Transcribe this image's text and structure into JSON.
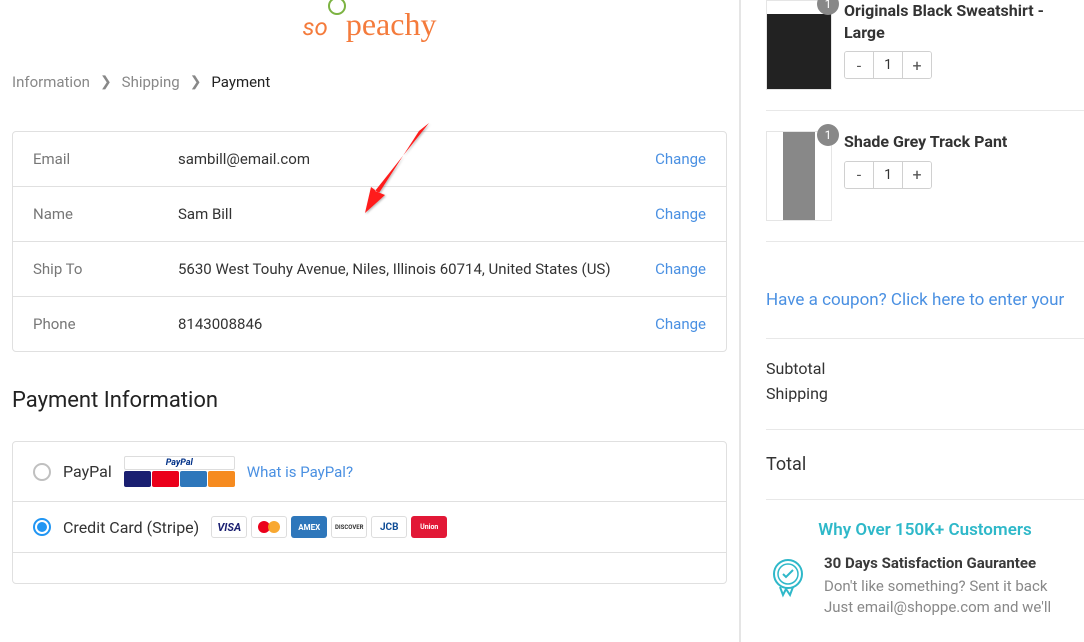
{
  "logo": {
    "part1": "so",
    "part2": "peachy"
  },
  "breadcrumbs": {
    "info": "Information",
    "shipping": "Shipping",
    "payment": "Payment"
  },
  "info": {
    "rows": [
      {
        "label": "Email",
        "value": "sambill@email.com",
        "change": "Change"
      },
      {
        "label": "Name",
        "value": "Sam Bill",
        "change": "Change"
      },
      {
        "label": "Ship To",
        "value": "5630 West Touhy Avenue, Niles, Illinois 60714, United States (US)",
        "change": "Change"
      },
      {
        "label": "Phone",
        "value": "8143008846",
        "change": "Change"
      }
    ]
  },
  "payment": {
    "title": "Payment Information",
    "options": {
      "paypal": {
        "label": "PayPal",
        "link": "What is PayPal?",
        "badge": "PayPal"
      },
      "stripe": {
        "label": "Credit Card (Stripe)"
      }
    }
  },
  "cart": {
    "items": [
      {
        "name": "Originals Black Sweatshirt - Large",
        "qty": "1"
      },
      {
        "name": "Shade Grey Track Pant",
        "qty": "1"
      }
    ],
    "coupon": "Have a coupon? Click here to enter your",
    "subtotal_label": "Subtotal",
    "shipping_label": "Shipping",
    "total_label": "Total"
  },
  "trust": {
    "title": "Why Over 150K+ Customers",
    "item1": {
      "heading": "30 Days Satisfaction Gaurantee",
      "line1": "Don't like something? Sent it back",
      "line2": "Just email@shoppe.com and we'll"
    }
  }
}
